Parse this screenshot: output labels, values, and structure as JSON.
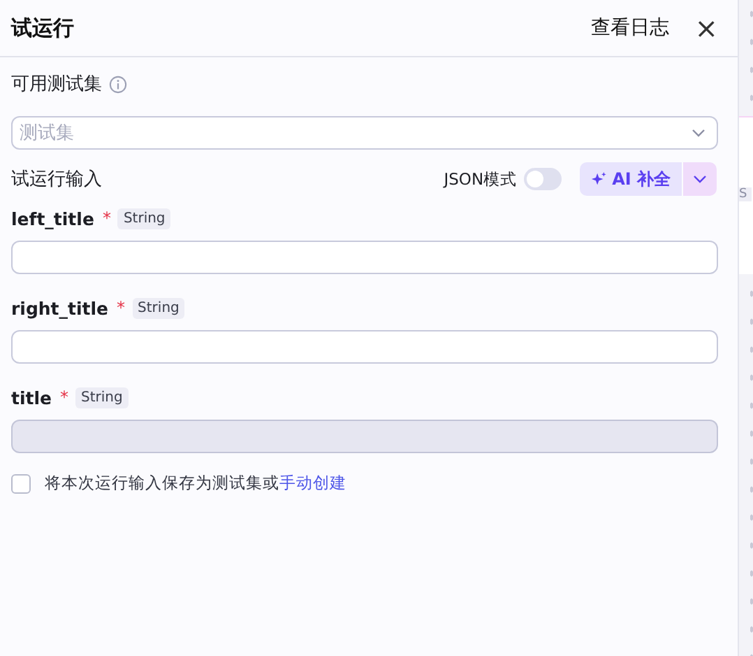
{
  "header": {
    "title": "试运行",
    "log_link": "查看日志",
    "close": "×"
  },
  "testset": {
    "label": "可用测试集",
    "select": {
      "placeholder": "测试集"
    }
  },
  "run_input": {
    "label": "试运行输入",
    "json_mode": {
      "label": "JSON模式",
      "on": false
    },
    "ai_button": "AI 补全"
  },
  "fields": [
    {
      "name": "left_title",
      "required": true,
      "required_mark": "*",
      "type": "String",
      "disabled": false
    },
    {
      "name": "right_title",
      "required": true,
      "required_mark": "*",
      "type": "String",
      "disabled": false
    },
    {
      "name": "title",
      "required": true,
      "required_mark": "*",
      "type": "String",
      "disabled": true
    }
  ],
  "save_option": {
    "checked": false,
    "text": "将本次运行输入保存为测试集或",
    "link": "手动创建"
  },
  "canvas_node": {
    "label": "S"
  }
}
